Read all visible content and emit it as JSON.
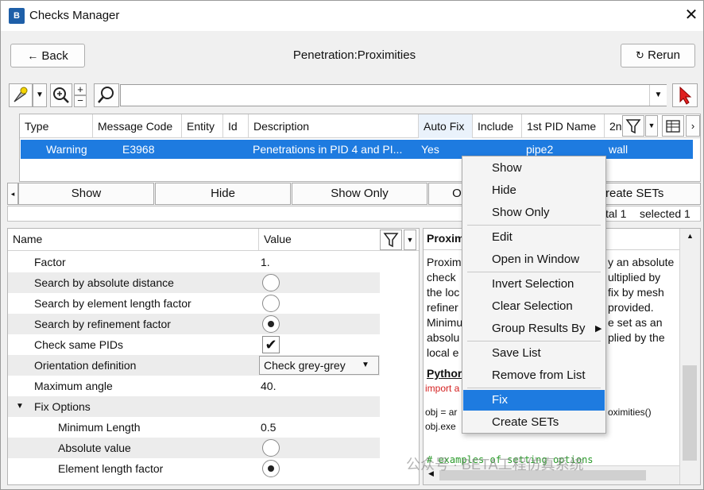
{
  "window": {
    "title": "Checks Manager",
    "close_glyph": "✕"
  },
  "nav": {
    "back_label": "Back",
    "heading": "Penetration:Proximities",
    "rerun_label": "Rerun"
  },
  "search": {
    "value": ""
  },
  "results_table": {
    "columns": [
      "Type",
      "Message Code",
      "Entity",
      "Id",
      "Description",
      "Auto Fix",
      "Include",
      "1st PID Name",
      "2n"
    ],
    "rows": [
      {
        "type": "Warning",
        "message_code": "E3968",
        "entity": "",
        "id": "",
        "description": "Penetrations in PID 4 and PI...",
        "auto_fix": "Yes",
        "include": "",
        "pid1_name": "pipe2",
        "pid2_name": "wall"
      }
    ]
  },
  "action_bar": {
    "show": "Show",
    "hide": "Hide",
    "show_only": "Show Only",
    "partial": "O",
    "create_sets": "reate SETs"
  },
  "status": {
    "total": "tal 1",
    "selected": "selected 1"
  },
  "properties": {
    "col_name": "Name",
    "col_value": "Value",
    "rows": [
      {
        "name": "Factor",
        "value": "1."
      },
      {
        "name": "Search by absolute distance",
        "radio": "off"
      },
      {
        "name": "Search by element length factor",
        "radio": "off"
      },
      {
        "name": "Search by refinement factor",
        "radio": "on"
      },
      {
        "name": "Check same PIDs",
        "check": "✔"
      },
      {
        "name": "Orientation definition",
        "select": "Check grey-grey"
      },
      {
        "name": "Maximum angle",
        "value": "40."
      },
      {
        "name": "Fix Options",
        "group": true
      },
      {
        "name": "Minimum Length",
        "value": "0.5"
      },
      {
        "name": "Absolute value",
        "radio": "off"
      },
      {
        "name": "Element length factor",
        "radio": "on"
      }
    ]
  },
  "help": {
    "title": "Proxim",
    "lines_left": [
      "Proxim",
      "check",
      "the loc",
      "refiner",
      "Minimu",
      "absolu",
      "local e"
    ],
    "lines_right": [
      "y an absolute",
      "ultiplied by",
      "fix by mesh",
      "provided.",
      "e set as an",
      "plied by the"
    ],
    "python_heading": "Pythor",
    "import_text": "import a",
    "code_line1_left": "obj = ar",
    "code_line1_right": "oximities()",
    "code_line2": "obj.exe",
    "comment": "# examples of setting options"
  },
  "context_menu": {
    "items": [
      {
        "label": "Show"
      },
      {
        "label": "Hide"
      },
      {
        "label": "Show Only"
      },
      {
        "label": "Edit"
      },
      {
        "label": "Open in Window"
      },
      {
        "label": "Invert Selection"
      },
      {
        "label": "Clear Selection"
      },
      {
        "label": "Group Results By"
      },
      {
        "label": "Save List"
      },
      {
        "label": "Remove from List"
      },
      {
        "label": "Fix"
      },
      {
        "label": "Create SETs"
      }
    ],
    "active_item": "Fix"
  },
  "watermark": "公众号 · BETA工程仿真系统",
  "colors": {
    "selection_blue": "#1e7be0",
    "cursor_red": "#e02020",
    "code_red": "#d42020",
    "comment_green": "#2a9a2a",
    "app_icon_blue": "#1e5fa8"
  },
  "icons": [
    "app-icon",
    "close-icon",
    "back-arrow-icon",
    "rerun-icon",
    "pointer-tool-icon",
    "zoom-icon",
    "search-icon",
    "cursor-pick-icon",
    "filter-icon",
    "columns-icon",
    "chevron-down-icon"
  ]
}
